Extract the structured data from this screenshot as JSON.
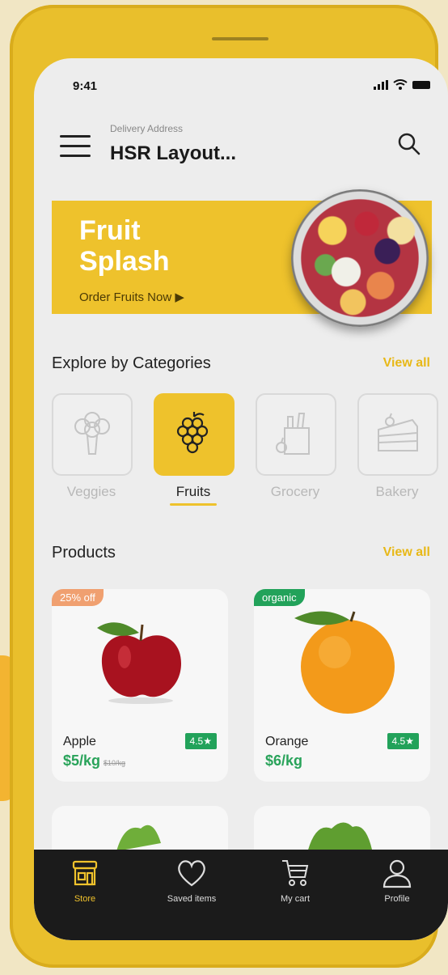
{
  "status": {
    "time": "9:41"
  },
  "header": {
    "address_label": "Delivery Address",
    "address_value": "HSR Layout..."
  },
  "banner": {
    "title_line1": "Fruit",
    "title_line2": "Splash",
    "cta": "Order Fruits Now ▶"
  },
  "categories": {
    "title": "Explore by Categories",
    "view_all": "View all",
    "items": [
      {
        "label": "Veggies",
        "icon": "broccoli-icon"
      },
      {
        "label": "Fruits",
        "icon": "grapes-icon",
        "active": true
      },
      {
        "label": "Grocery",
        "icon": "grocery-bag-icon"
      },
      {
        "label": "Bakery",
        "icon": "cake-slice-icon"
      }
    ]
  },
  "products": {
    "title": "Products",
    "view_all": "View all",
    "items": [
      {
        "badge": "25% off",
        "badge_color": "#f0a070",
        "name": "Apple",
        "price": "$5/kg",
        "old_price": "$10/kg",
        "rating": "4.5★"
      },
      {
        "badge": "organic",
        "badge_color": "#22a25a",
        "name": "Orange",
        "price": "$6/kg",
        "rating": "4.5★"
      }
    ]
  },
  "tabbar": {
    "items": [
      {
        "label": "Store",
        "icon": "store-icon",
        "active": true
      },
      {
        "label": "Saved items",
        "icon": "heart-icon"
      },
      {
        "label": "My cart",
        "icon": "cart-icon"
      },
      {
        "label": "Profile",
        "icon": "profile-icon"
      }
    ]
  },
  "colors": {
    "accent": "#eec22c",
    "price_green": "#29a35a",
    "tabbar_bg": "#1b1b1b"
  }
}
